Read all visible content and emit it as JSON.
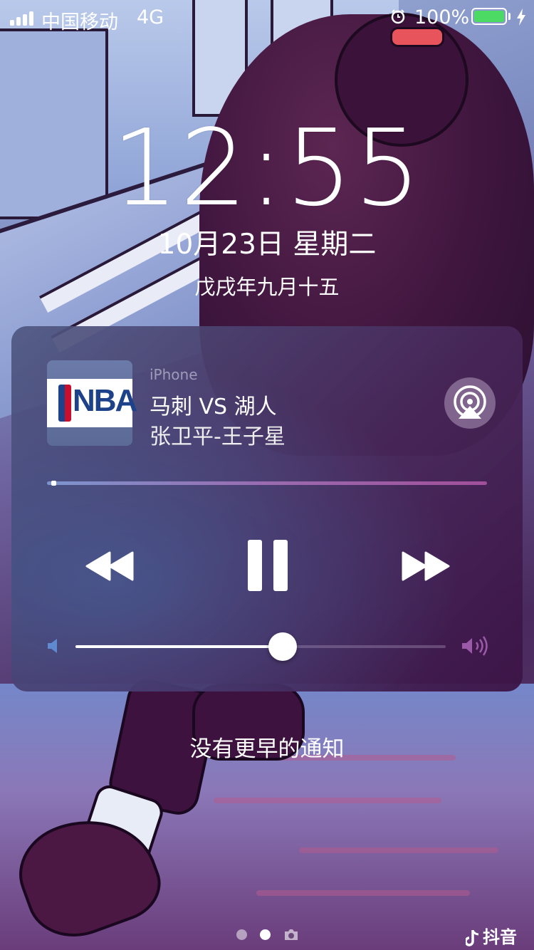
{
  "status_bar": {
    "carrier": "中国移动",
    "network": "4G",
    "battery_percent": "100%",
    "battery_level": 1.0,
    "icons": [
      "signal-icon",
      "alarm-icon",
      "battery-icon",
      "charging-bolt-icon"
    ],
    "battery_color": "#4cd964"
  },
  "lock_screen": {
    "time": "12:55",
    "date": "10月23日 星期二",
    "lunar_date": "戊戌年九月十五"
  },
  "now_playing": {
    "source": "iPhone",
    "title": "马刺 VS 湖人",
    "artist": "张卫平-王子星",
    "artwork_text": "NBA",
    "progress": 0.01,
    "volume": 0.56,
    "icons": [
      "rewind-icon",
      "pause-icon",
      "fast-forward-icon",
      "airplay-icon",
      "volume-low-icon",
      "volume-high-icon"
    ]
  },
  "notifications": {
    "empty_text": "没有更早的通知"
  },
  "pages": {
    "count": 2,
    "active_index": 1
  },
  "watermark": {
    "text": "抖音"
  }
}
